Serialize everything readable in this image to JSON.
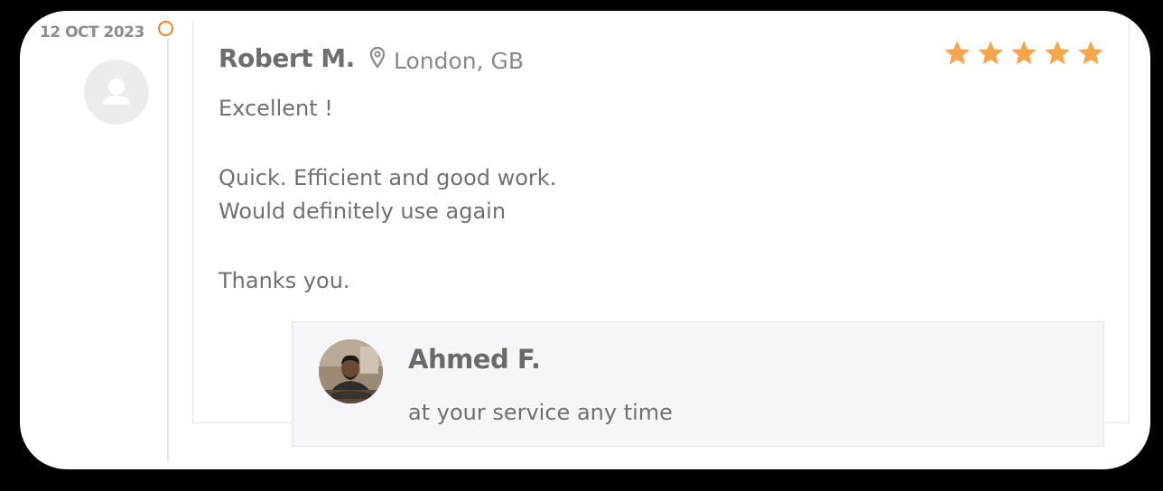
{
  "review": {
    "date": "12 OCT 2023",
    "reviewer_name": "Robert M.",
    "location": "London, GB",
    "rating": 5,
    "rating_max": 5,
    "text": {
      "line1": "Excellent !",
      "line2": "Quick. Efficient and good work.",
      "line3": "Would definitely use again",
      "line4": "Thanks you."
    }
  },
  "reply": {
    "name": "Ahmed F.",
    "text": "at your service any time"
  },
  "icons": {
    "timeline_dot": "circle-outline-icon",
    "avatar": "user-silhouette-icon",
    "location": "map-pin-icon",
    "rating": "star-icon"
  },
  "colors": {
    "accent": "#f58220",
    "star": "#f7a54a",
    "reply_bg": "#f5f6fa",
    "text": "#707070"
  }
}
